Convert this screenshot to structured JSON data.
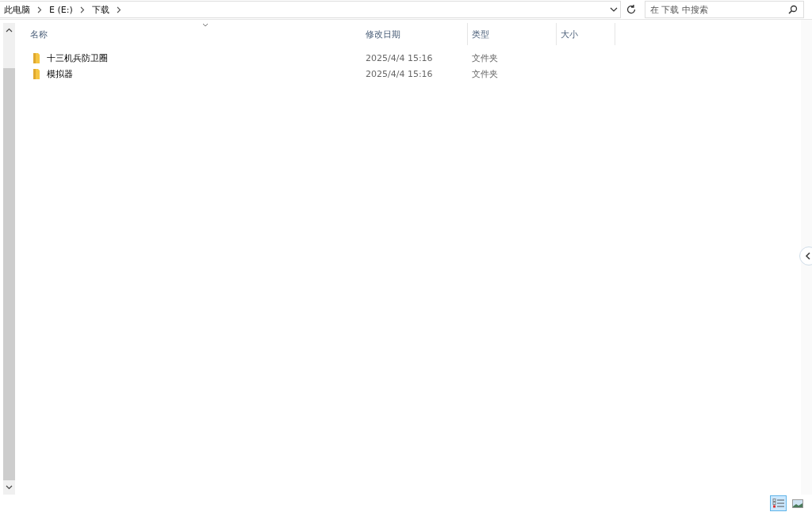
{
  "address_bar": {
    "crumbs": [
      "此电脑",
      "E (E:)",
      "下载"
    ]
  },
  "search": {
    "placeholder": "在 下载 中搜索"
  },
  "columns": [
    "名称",
    "修改日期",
    "类型",
    "大小"
  ],
  "rows": [
    {
      "name": "十三机兵防卫圈",
      "modified": "2025/4/4 15:16",
      "type": "文件夹"
    },
    {
      "name": "模拟器",
      "modified": "2025/4/4 15:16",
      "type": "文件夹"
    }
  ],
  "view_buttons": [
    {
      "kind": "details",
      "selected": true
    },
    {
      "kind": "large-icons",
      "selected": false
    }
  ]
}
